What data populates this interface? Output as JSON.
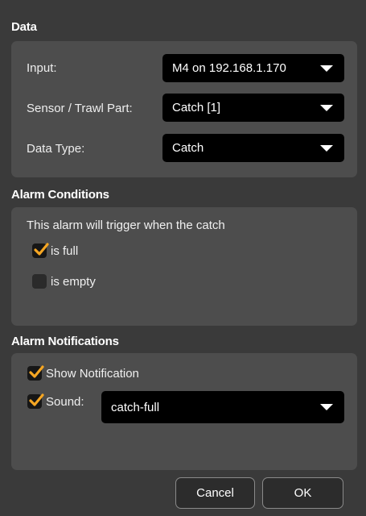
{
  "data_section": {
    "title": "Data",
    "input": {
      "label": "Input:",
      "value": "M4 on 192.168.1.170"
    },
    "sensor": {
      "label": "Sensor / Trawl Part:",
      "value": "Catch [1]"
    },
    "data_type": {
      "label": "Data Type:",
      "value": "Catch"
    }
  },
  "conditions": {
    "title": "Alarm Conditions",
    "description": "This alarm will trigger when the catch",
    "options": [
      {
        "label": "is full",
        "checked": true
      },
      {
        "label": "is empty",
        "checked": false
      }
    ]
  },
  "notifications": {
    "title": "Alarm Notifications",
    "show_notification": {
      "label": "Show Notification",
      "checked": true
    },
    "sound": {
      "label": "Sound:",
      "checked": true,
      "value": "catch-full"
    }
  },
  "buttons": {
    "cancel": "Cancel",
    "ok": "OK"
  },
  "colors": {
    "check_accent": "#f5a623",
    "panel_bg": "#4d4d4d",
    "window_bg": "#3a3a3a"
  },
  "icons": {
    "checkmark": "checkmark-icon",
    "dropdown": "chevron-down-icon"
  }
}
